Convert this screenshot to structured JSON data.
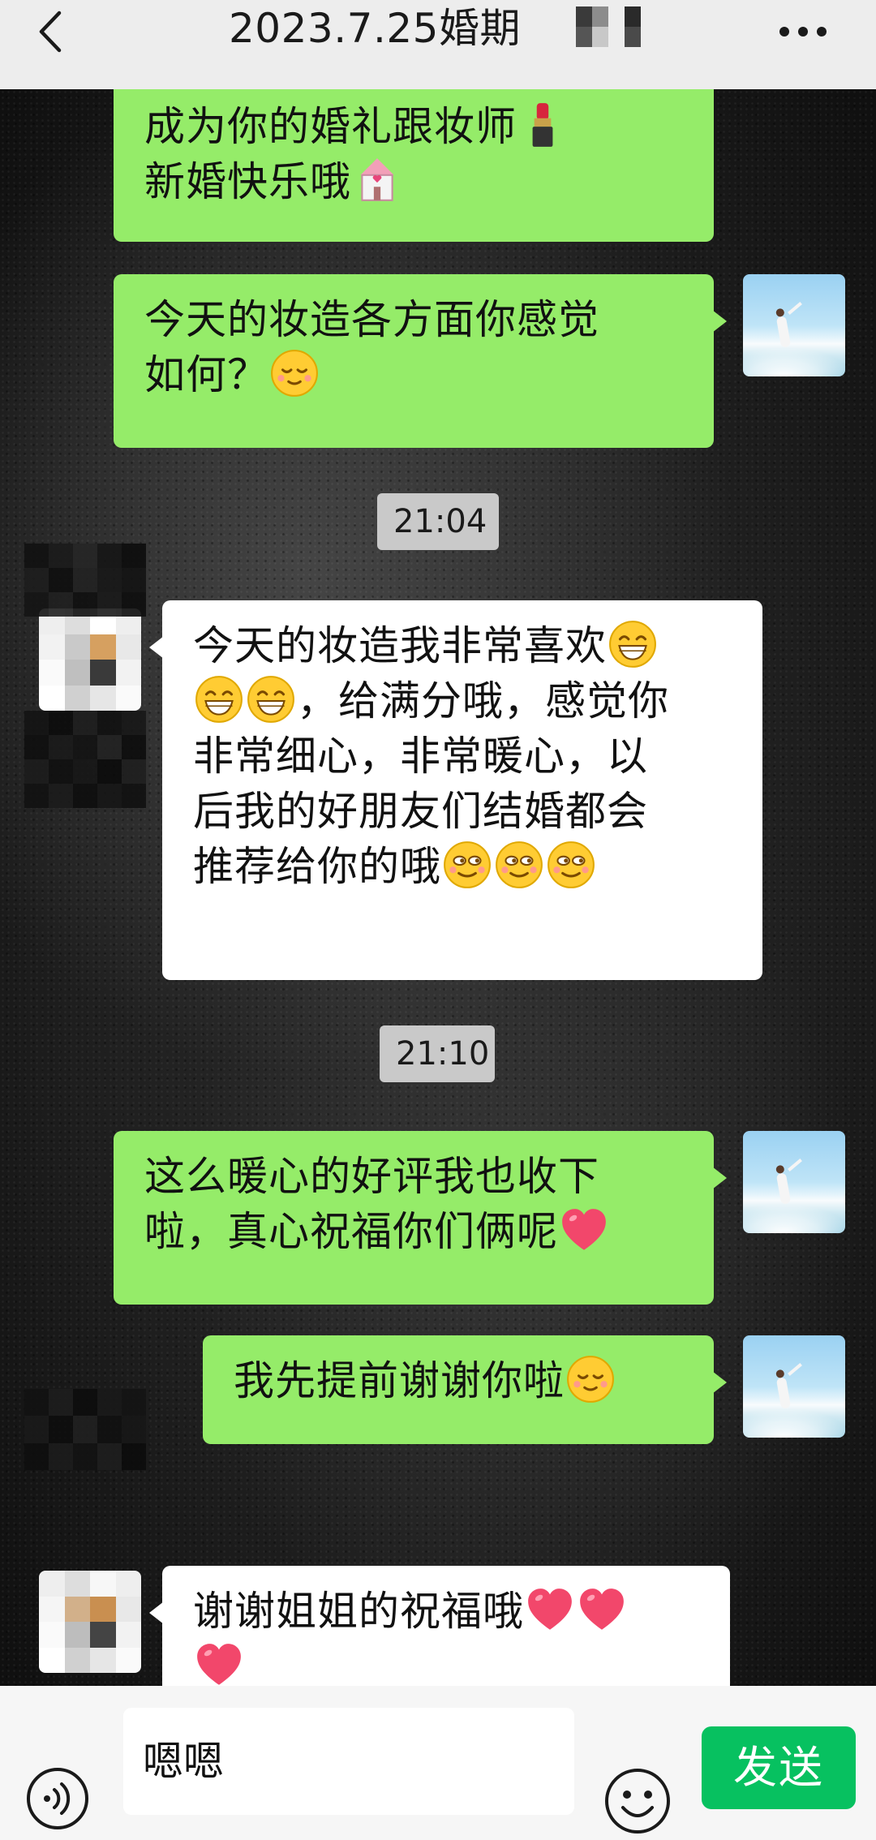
{
  "header": {
    "title": "2023.7.25婚期",
    "back_icon": "chevron-left-icon",
    "more_icon": "ellipsis-icon"
  },
  "messages": [
    {
      "sender": "me",
      "lines": [
        "成为你的婚礼跟妆师",
        "新婚快乐哦"
      ],
      "emojis": [
        "lipstick",
        "wedding-chapel"
      ]
    },
    {
      "sender": "me",
      "lines": [
        "今天的妆造各方面你感觉",
        "如何？"
      ],
      "emojis": [
        "shy-smile"
      ]
    },
    {
      "type": "time",
      "text": "21:04"
    },
    {
      "sender": "them",
      "lines": [
        "今天的妆造我非常喜欢",
        "，给满分哦，感觉你",
        "非常细心，非常暖心，以",
        "后我的好朋友们结婚都会",
        "推荐给你的哦"
      ],
      "emojis": [
        "grin",
        "grin",
        "grin",
        "smirk",
        "smirk",
        "smirk"
      ]
    },
    {
      "type": "time",
      "text": "21:10"
    },
    {
      "sender": "me",
      "lines": [
        "这么暖心的好评我也收下",
        "啦，真心祝福你们俩呢"
      ],
      "emojis": [
        "heart"
      ]
    },
    {
      "sender": "me",
      "lines": [
        "我先提前谢谢你啦"
      ],
      "emojis": [
        "shy-smile"
      ]
    },
    {
      "sender": "them",
      "lines": [
        "谢谢姐姐的祝福哦"
      ],
      "emojis": [
        "heart",
        "heart",
        "heart"
      ]
    }
  ],
  "input": {
    "voice_icon": "voice-icon",
    "value": "嗯嗯",
    "emoji_icon": "emoji-icon",
    "send_label": "发送"
  },
  "colors": {
    "my_bubble": "#95ec69",
    "their_bubble": "#ffffff",
    "send_button": "#07c160",
    "header_bg": "#ededed"
  }
}
